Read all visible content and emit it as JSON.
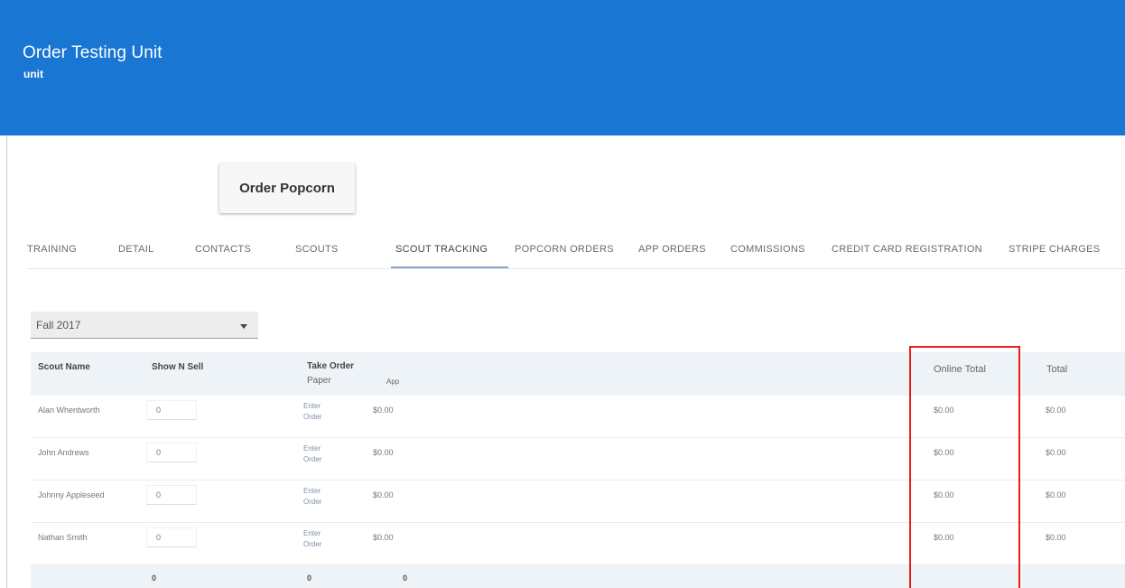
{
  "header": {
    "title": "Order Testing Unit",
    "subtitle": "unit",
    "color": "#1976d2"
  },
  "order_button": {
    "label": "Order Popcorn"
  },
  "tabs": [
    {
      "label": "TRAINING",
      "active": false
    },
    {
      "label": "DETAIL",
      "active": false
    },
    {
      "label": "CONTACTS",
      "active": false
    },
    {
      "label": "SCOUTS",
      "active": false
    },
    {
      "label": "SCOUT TRACKING",
      "active": true
    },
    {
      "label": "POPCORN ORDERS",
      "active": false
    },
    {
      "label": "APP ORDERS",
      "active": false
    },
    {
      "label": "COMMISSIONS",
      "active": false
    },
    {
      "label": "CREDIT CARD REGISTRATION",
      "active": false
    },
    {
      "label": "STRIPE CHARGES",
      "active": false
    }
  ],
  "season_select": {
    "value": "Fall 2017"
  },
  "table": {
    "columns": {
      "scout_name": "Scout Name",
      "show_n_sell": "Show N Sell",
      "take_order_line1": "Take Order",
      "take_order_line2": "Paper",
      "app": "App",
      "online_total": "Online Total",
      "total": "Total"
    },
    "rows": [
      {
        "name": "Alan Whentworth",
        "show_n_sell": "0",
        "enter_order_line1": "Enter",
        "enter_order_line2": "Order",
        "amount": "$0.00",
        "online_total": "$0.00",
        "total": "$0.00"
      },
      {
        "name": "John Andrews",
        "show_n_sell": "0",
        "enter_order_line1": "Enter",
        "enter_order_line2": "Order",
        "amount": "$0.00",
        "online_total": "$0.00",
        "total": "$0.00"
      },
      {
        "name": "Johnny Appleseed",
        "show_n_sell": "0",
        "enter_order_line1": "Enter",
        "enter_order_line2": "Order",
        "amount": "$0.00",
        "online_total": "$0.00",
        "total": "$0.00"
      },
      {
        "name": "Nathan Smith",
        "show_n_sell": "0",
        "enter_order_line1": "Enter",
        "enter_order_line2": "Order",
        "amount": "$0.00",
        "online_total": "$0.00",
        "total": "$0.00"
      }
    ],
    "totals": {
      "show_n_sell": "0",
      "take_order": "0",
      "app": "0"
    }
  },
  "annotation": {
    "highlight_color": "#e8201c"
  }
}
